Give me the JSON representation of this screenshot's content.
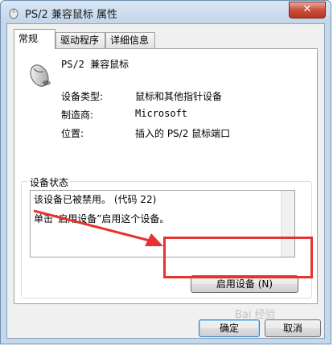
{
  "window": {
    "title": "PS/2 兼容鼠标 属性",
    "close_label": "✕"
  },
  "tabs": [
    {
      "label": "常规",
      "active": true
    },
    {
      "label": "驱动程序",
      "active": false
    },
    {
      "label": "详细信息",
      "active": false
    }
  ],
  "device": {
    "name": "PS/2 兼容鼠标",
    "icon": "mouse-icon"
  },
  "properties": {
    "type_label": "设备类型:",
    "type_value": "鼠标和其他指针设备",
    "maker_label": "制造商:",
    "maker_value": "Microsoft",
    "location_label": "位置:",
    "location_value": "插入的 PS/2 鼠标端口"
  },
  "status": {
    "group_label": "设备状态",
    "line1": "该设备已被禁用。 (代码 22)",
    "line2": "单击“启用设备”启用这个设备。"
  },
  "buttons": {
    "enable": "启用设备 (N)",
    "ok": "确定",
    "cancel": "取消"
  },
  "watermark": "Bai 经验",
  "colors": {
    "annotation_red": "#e53333",
    "title_bg": "#c3d5ea"
  }
}
